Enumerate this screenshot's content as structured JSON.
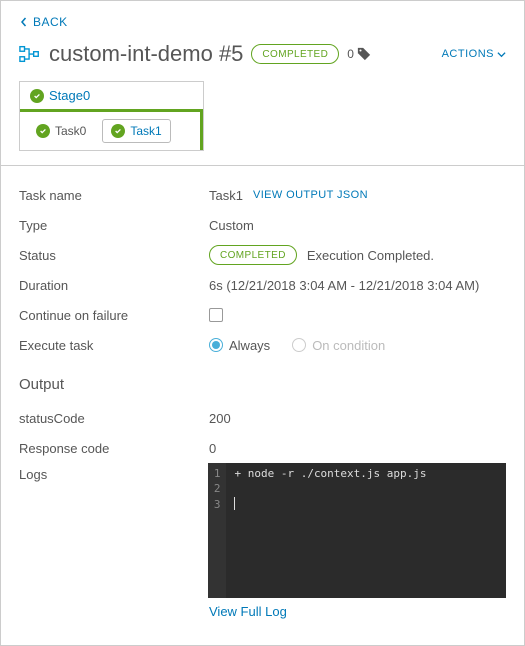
{
  "nav": {
    "back": "BACK"
  },
  "header": {
    "title": "custom-int-demo #5",
    "status_badge": "COMPLETED",
    "tag_count": "0",
    "actions_label": "ACTIONS"
  },
  "stage": {
    "name": "Stage0",
    "tasks": [
      {
        "name": "Task0",
        "active": false
      },
      {
        "name": "Task1",
        "active": true
      }
    ]
  },
  "details": {
    "task_name_label": "Task name",
    "task_name_value": "Task1",
    "view_output_json": "VIEW OUTPUT JSON",
    "type_label": "Type",
    "type_value": "Custom",
    "status_label": "Status",
    "status_badge": "COMPLETED",
    "status_text": "Execution Completed.",
    "duration_label": "Duration",
    "duration_value": "6s (12/21/2018 3:04 AM - 12/21/2018 3:04 AM)",
    "continue_label": "Continue on failure",
    "continue_checked": false,
    "execute_label": "Execute task",
    "execute_options": {
      "always": "Always",
      "on_condition": "On condition"
    }
  },
  "output": {
    "heading": "Output",
    "status_code_label": "statusCode",
    "status_code_value": "200",
    "response_code_label": "Response code",
    "response_code_value": "0",
    "logs_label": "Logs",
    "logs_lines": "+ node -r ./context.js app.js",
    "view_full_log": "View Full Log"
  }
}
